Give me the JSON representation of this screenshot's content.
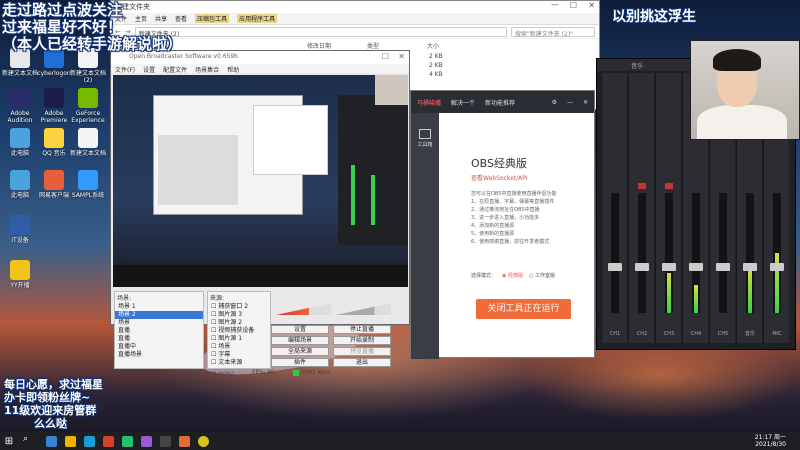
{
  "overlay": {
    "top_left_lines": [
      "走过路过点波关注",
      "过来福星好不好！",
      "（本人已经转手游解说啦）"
    ],
    "top_right": "以别挑这浮生",
    "bottom_left_lines": [
      "每日心愿，求过福星",
      "办卡即领粉丝牌~",
      "11级欢迎来房管群",
      "么么哒"
    ]
  },
  "desktop_icons": [
    {
      "label": "新建文本文档"
    },
    {
      "label": "cyberlogon"
    },
    {
      "label": "新建文本文档 (2)"
    },
    {
      "label": "Adobe Audition"
    },
    {
      "label": "Adobe Premiere"
    },
    {
      "label": "GeForce Experience"
    },
    {
      "label": "此电脑"
    },
    {
      "label": "QQ 音乐"
    },
    {
      "label": "新建文本文档"
    },
    {
      "label": "此电脑"
    },
    {
      "label": "网易客户端"
    },
    {
      "label": "SAMPL系统"
    },
    {
      "label": "IT设备"
    },
    {
      "label": "YY开播"
    }
  ],
  "explorer": {
    "title": "新建文件夹",
    "ribbon_tabs": [
      "文件",
      "主页",
      "共享",
      "查看",
      "压缩包工具",
      "应用程序工具"
    ],
    "address": "新建文件夹 (2)",
    "search_placeholder": "搜索\"新建文件夹 (2)\"",
    "columns": [
      "修改日期",
      "类型",
      "大小"
    ],
    "rows": [
      {
        "size": "2 KB"
      },
      {
        "size": "2 KB"
      },
      {
        "size": "4 KB"
      }
    ]
  },
  "obs": {
    "title": "Open Broadcaster Software v0.659b",
    "menu": [
      "文件(F)",
      "设置",
      "配置文件",
      "场景集合",
      "帮助"
    ],
    "scenes_title": "场景:",
    "scenes": [
      "场景 1",
      "场景 2",
      "场景",
      "直播",
      "直播",
      "直播中",
      "直播场景"
    ],
    "sources_title": "来源:",
    "sources": [
      "捕获窗口 2",
      "图片源 3",
      "图片源 2",
      "视频捕获设备",
      "图片源 1",
      "场景",
      "字幕",
      "文本来源"
    ],
    "buttons": {
      "settings": "设置",
      "stop_stream": "停止直播",
      "edit_scene": "编辑场景",
      "start_record": "开始录制",
      "global_sources": "全局来源",
      "preview": "预览直播",
      "plugins": "插件",
      "exit": "退出"
    },
    "status": {
      "time": "0:00:01 (LIVE)",
      "dropped": "丢失帧数: 0 (0.00%)",
      "fps": "FPS: 30",
      "bitrate": "3091 kb/s"
    }
  },
  "obs_classic": {
    "top_items": [
      "马桶喵播",
      "解决一个",
      "新功能推荐"
    ],
    "side_label": "工具箱",
    "heading": "OBS经典版",
    "link": "查看WebSocket/API",
    "lines": [
      "您可以在OBS中直接使用直播伴侣功能",
      "1、在原直播、字幕、弹幕等直播插件",
      "2、通过推流地址在OBS中直播",
      "3、进一步进入直播，小功能多",
      "4、添加新的直播源",
      "5、使用新的直播源",
      "6、使用感谢直播，前往开发者模式"
    ],
    "mode_label": "选择模式：",
    "mode_options": [
      "经典版",
      "工作室版"
    ],
    "run_button": "关闭工具正在运行"
  },
  "mixer": {
    "header_label": "音乐",
    "channel_labels": [
      "CH1",
      "CH2",
      "CH3",
      "CH4",
      "CH5",
      "音乐",
      "MIC"
    ]
  },
  "taskbar": {
    "time": "21:17 周一",
    "date": "2021/8/30"
  }
}
